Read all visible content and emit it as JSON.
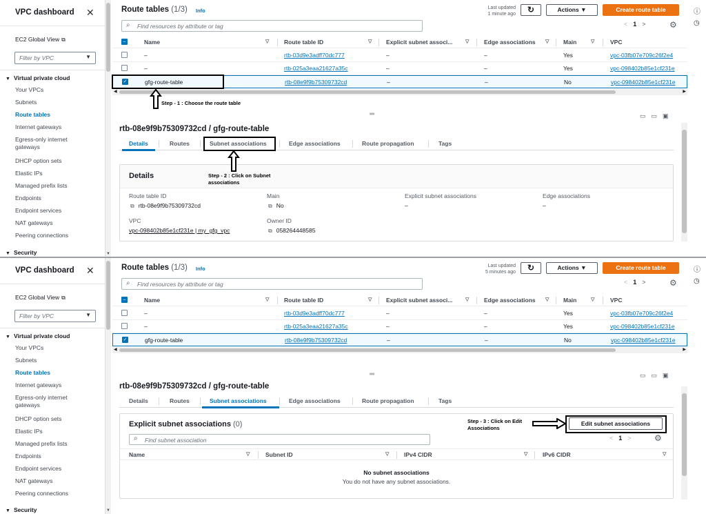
{
  "sidebar": {
    "title": "VPC dashboard",
    "ec2_global_view": "EC2 Global View",
    "filter_placeholder": "Filter by VPC",
    "section_vpc": "Virtual private cloud",
    "items": [
      "Your VPCs",
      "Subnets",
      "Route tables",
      "Internet gateways",
      "Egress-only internet gateways",
      "DHCP option sets",
      "Elastic IPs",
      "Managed prefix lists",
      "Endpoints",
      "Endpoint services",
      "NAT gateways",
      "Peering connections"
    ],
    "section_security": "Security"
  },
  "route_tables": {
    "title": "Route tables",
    "count": "(1/3)",
    "info": "Info",
    "last_updated_label": "Last updated",
    "last_updated_p1": "1 minute ago",
    "last_updated_p2": "5 minutes ago",
    "actions": "Actions",
    "create": "Create route table",
    "search_placeholder": "Find resources by attribute or tag",
    "page": "1",
    "columns": [
      "Name",
      "Route table ID",
      "Explicit subnet associ...",
      "Edge associations",
      "Main",
      "VPC"
    ],
    "rows": [
      {
        "name": "–",
        "id": "rtb-03d9e3adff70dc777",
        "explicit": "–",
        "edge": "–",
        "main": "Yes",
        "vpc": "vpc-03fb07e709c26f2e4"
      },
      {
        "name": "–",
        "id": "rtb-025a3eaa21627a35c",
        "explicit": "–",
        "edge": "–",
        "main": "Yes",
        "vpc": "vpc-098402b85e1cf231e"
      },
      {
        "name": "gfg-route-table",
        "id": "rtb-08e9f9b75309732cd",
        "explicit": "–",
        "edge": "–",
        "main": "No",
        "vpc": "vpc-098402b85e1cf231e"
      }
    ]
  },
  "annotations": {
    "step1": "Step - 1 : Choose the route table",
    "step2_line1": "Step - 2 : Click on Subnet",
    "step2_line2": "associations",
    "step3_line1": "Step - 3 : Click on Edit",
    "step3_line2": "Associations"
  },
  "detail": {
    "title": "rtb-08e9f9b75309732cd / gfg-route-table",
    "tabs": [
      "Details",
      "Routes",
      "Subnet associations",
      "Edge associations",
      "Route propagation",
      "Tags"
    ],
    "details_heading": "Details",
    "route_table_id_label": "Route table ID",
    "route_table_id": "rtb-08e9f9b75309732cd",
    "main_label": "Main",
    "main_value": "No",
    "explicit_label": "Explicit subnet associations",
    "explicit_value": "–",
    "edge_label": "Edge associations",
    "edge_value": "–",
    "vpc_label": "VPC",
    "vpc_value": "vpc-098402b85e1cf231e | my_gfg_vpc",
    "owner_label": "Owner ID",
    "owner_value": "058264448585"
  },
  "subnet_assoc": {
    "title": "Explicit subnet associations",
    "count": "(0)",
    "edit_button": "Edit subnet associations",
    "search_placeholder": "Find subnet association",
    "page": "1",
    "columns": [
      "Name",
      "Subnet ID",
      "IPv4 CIDR",
      "IPv6 CIDR"
    ],
    "empty_title": "No subnet associations",
    "empty_desc": "You do not have any subnet associations."
  },
  "colors": {
    "accent": "#0073bb",
    "primary_button": "#ec7211",
    "sidebar_active": "#0073bb"
  }
}
